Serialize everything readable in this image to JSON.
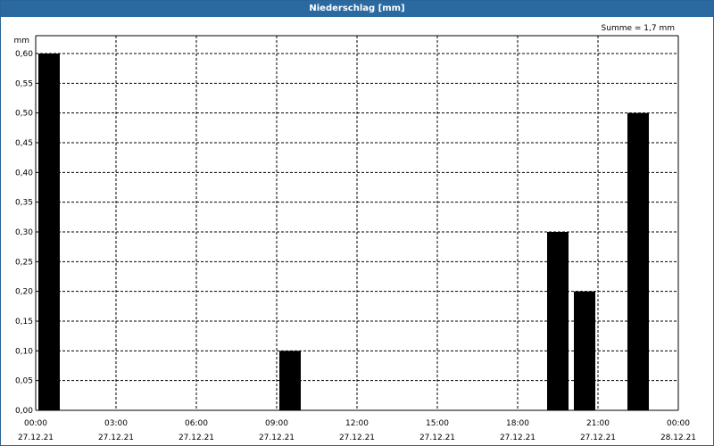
{
  "window": {
    "title": "Niederschlag [mm]"
  },
  "chart_data": {
    "type": "bar",
    "title": "Niederschlag [mm]",
    "ylabel": "mm",
    "xlabel": "",
    "summary": "Summe = 1,7 mm",
    "ylim": [
      0,
      0.6
    ],
    "y_ticks": [
      "0,00",
      "0,05",
      "0,10",
      "0,15",
      "0,20",
      "0,25",
      "0,30",
      "0,35",
      "0,40",
      "0,45",
      "0,50",
      "0,55",
      "0,60"
    ],
    "x_ticks": [
      {
        "time": "00:00",
        "date": "27.12.21"
      },
      {
        "time": "03:00",
        "date": "27.12.21"
      },
      {
        "time": "06:00",
        "date": "27.12.21"
      },
      {
        "time": "09:00",
        "date": "27.12.21"
      },
      {
        "time": "12:00",
        "date": "27.12.21"
      },
      {
        "time": "15:00",
        "date": "27.12.21"
      },
      {
        "time": "18:00",
        "date": "27.12.21"
      },
      {
        "time": "21:00",
        "date": "27.12.21"
      },
      {
        "time": "00:00",
        "date": "28.12.21"
      }
    ],
    "grid": true,
    "bar_color": "#000000",
    "series": [
      {
        "values": [
          {
            "start": "27.12.21 00:00",
            "end": "27.12.21 01:00",
            "value": 0.6
          },
          {
            "start": "27.12.21 09:00",
            "end": "27.12.21 10:00",
            "value": 0.1
          },
          {
            "start": "27.12.21 19:00",
            "end": "27.12.21 20:00",
            "value": 0.3
          },
          {
            "start": "27.12.21 20:00",
            "end": "27.12.21 21:00",
            "value": 0.2
          },
          {
            "start": "27.12.21 22:00",
            "end": "27.12.21 23:00",
            "value": 0.5
          }
        ]
      }
    ]
  }
}
